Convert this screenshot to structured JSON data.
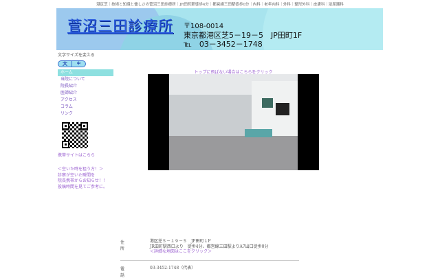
{
  "topbar": "港区芝｜技術と知識と優しさの菅沼三田診療所｜JR田町駅徒歩4分｜都営線三田駅徒歩0分｜内科｜老年内科｜外科｜整形外科｜皮膚科｜泌尿器科",
  "header": {
    "logo": "菅沼三田診療所",
    "postal": "〒108-0014",
    "address": "東京都港区芝5－19－5　JP田町1F",
    "tel": "℡　03－3452－1748"
  },
  "font_size": {
    "label": "文字サイズを変える",
    "large": "大",
    "medium": "中"
  },
  "nav": [
    "ホーム",
    "当院について",
    "院長紹介",
    "医師紹介",
    "アクセス",
    "コラム",
    "リンク"
  ],
  "mobile_link": "携帯サイトはこちら",
  "notice": [
    "＜空いた時を狙う方！＞",
    "診察が空いた瞬間を",
    "院長携帯からお知らせ！！",
    "投稿時間を見てご参考に。"
  ],
  "main": {
    "top_link": "トップに飛ばない場合はこちらをクリック"
  },
  "info": {
    "address_label": "住所",
    "address_lines": [
      "港区芝５－１９－５　JP田町１F",
      "JR田町駅西口より　徒歩4分、都営線三田駅よりA7出口徒歩0分"
    ],
    "map_link": "＜詳細な地図はここをクリック＞",
    "phone_label": "電話",
    "phone": "03-3452-1748（代表）"
  }
}
